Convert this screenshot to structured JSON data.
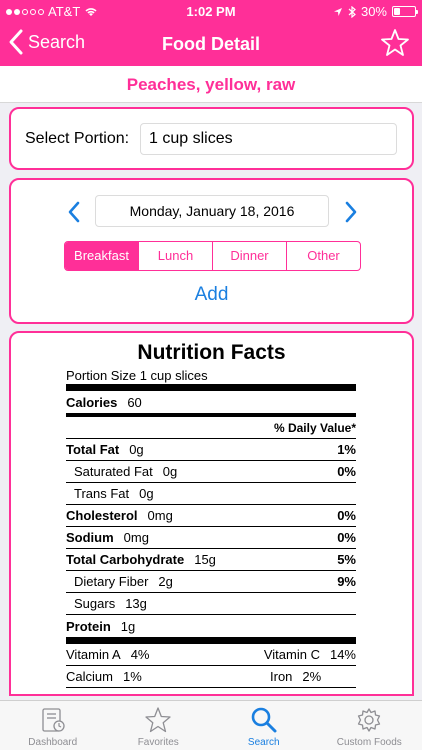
{
  "status": {
    "carrier": "AT&T",
    "time": "1:02 PM",
    "battery": "30%",
    "battery_level": 0.3
  },
  "nav": {
    "back_label": "Search",
    "title": "Food Detail"
  },
  "food": {
    "name": "Peaches, yellow, raw"
  },
  "portion": {
    "label": "Select Portion:",
    "value": "1 cup slices"
  },
  "date": {
    "value": "Monday, January 18, 2016"
  },
  "meals": {
    "items": [
      "Breakfast",
      "Lunch",
      "Dinner",
      "Other"
    ],
    "selected": "Breakfast"
  },
  "add_label": "Add",
  "nutrition": {
    "title": "Nutrition Facts",
    "portion_size_label": "Portion Size",
    "portion_size_value": "1 cup slices",
    "calories_label": "Calories",
    "calories_value": "60",
    "dv_header": "% Daily Value*",
    "rows": [
      {
        "label": "Total Fat",
        "amount": "0g",
        "dv": "1%"
      },
      {
        "label": "Saturated Fat",
        "amount": "0g",
        "dv": "0%"
      },
      {
        "label": "Trans Fat",
        "amount": "0g",
        "dv": ""
      },
      {
        "label": "Cholesterol",
        "amount": "0mg",
        "dv": "0%"
      },
      {
        "label": "Sodium",
        "amount": "0mg",
        "dv": "0%"
      },
      {
        "label": "Total Carbohydrate",
        "amount": "15g",
        "dv": "5%"
      },
      {
        "label": "Dietary Fiber",
        "amount": "2g",
        "dv": "9%"
      },
      {
        "label": "Sugars",
        "amount": "13g",
        "dv": ""
      },
      {
        "label": "Protein",
        "amount": "1g",
        "dv": ""
      }
    ],
    "vitamins": [
      {
        "left_label": "Vitamin A",
        "left_value": "4%",
        "right_label": "Vitamin C",
        "right_value": "14%"
      },
      {
        "left_label": "Calcium",
        "left_value": "1%",
        "right_label": "Iron",
        "right_value": "2%"
      }
    ]
  },
  "tabs": [
    {
      "label": "Dashboard",
      "icon": "dashboard-icon"
    },
    {
      "label": "Favorites",
      "icon": "star-icon"
    },
    {
      "label": "Search",
      "icon": "search-icon",
      "active": true
    },
    {
      "label": "Custom Foods",
      "icon": "gear-icon"
    }
  ],
  "colors": {
    "accent": "#ff2f98",
    "link": "#1a7fe0"
  }
}
